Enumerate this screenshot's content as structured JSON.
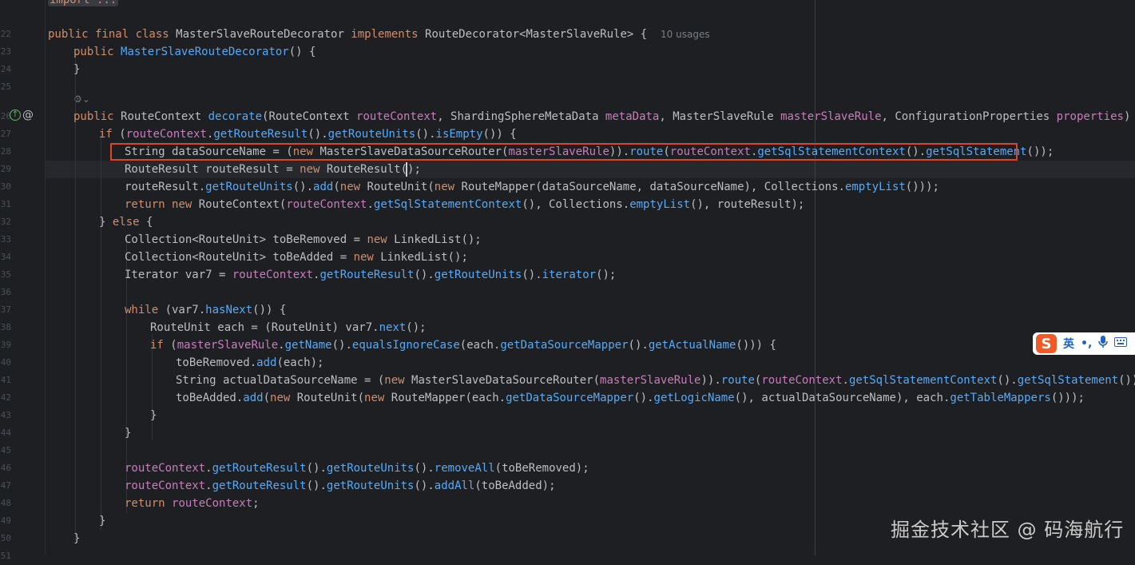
{
  "editor": {
    "line_numbers": [
      "",
      "22",
      "23",
      "24",
      "25",
      "26",
      "27",
      "28",
      "29",
      "30",
      "31",
      "32",
      "33",
      "34",
      "35",
      "36",
      "37",
      "38",
      "39",
      "40",
      "41",
      "42",
      "43",
      "44",
      "45",
      "46",
      "47",
      "48",
      "49",
      "50",
      "51"
    ],
    "usages_hint": "10 usages",
    "folded_import": "import ...",
    "lines": {
      "l0_kw": "import",
      "l0_rest": " ...",
      "l1_a": "public final class ",
      "l1_b": "MasterSlaveRouteDecorator",
      "l1_c": " implements ",
      "l1_d": "RouteDecorator<MasterSlaveRule> {",
      "l2_a": "public ",
      "l2_b": "MasterSlaveRouteDecorator",
      "l2_c": "() {",
      "l3": "}",
      "l5_a": "public ",
      "l5_b": "RouteContext ",
      "l5_c": "decorate",
      "l5_d": "(RouteContext ",
      "l5_e": "routeContext",
      "l5_f": ", ShardingSphereMetaData ",
      "l5_g": "metaData",
      "l5_h": ", MasterSlaveRule ",
      "l5_i": "masterSlaveRule",
      "l5_j": ", ConfigurationProperties ",
      "l5_k": "properties",
      "l5_l": ") {",
      "l6_a": "if ",
      "l6_b": "(",
      "l6_c": "routeContext",
      "l6_d": ".",
      "l6_e": "getRouteResult",
      "l6_f": "().",
      "l6_g": "getRouteUnits",
      "l6_h": "().",
      "l6_i": "isEmpty",
      "l6_j": "()) {",
      "l7_a": "String dataSourceName = (",
      "l7_b": "new ",
      "l7_c": "MasterSlaveDataSourceRouter(",
      "l7_d": "masterSlaveRule",
      "l7_e": ")).",
      "l7_f": "route",
      "l7_g": "(",
      "l7_h": "routeContext",
      "l7_i": ".",
      "l7_j": "getSqlStatementContext",
      "l7_k": "().",
      "l7_l": "getSqlStatement",
      "l7_m": "());",
      "l8_a": "RouteResult routeResult = ",
      "l8_b": "new ",
      "l8_c": "RouteResult();",
      "l9_a": "routeResult.",
      "l9_b": "getRouteUnits",
      "l9_c": "().",
      "l9_d": "add",
      "l9_e": "(",
      "l9_f": "new ",
      "l9_g": "RouteUnit(",
      "l9_h": "new ",
      "l9_i": "RouteMapper(dataSourceName, dataSourceName), Collections.",
      "l9_j": "emptyList",
      "l9_k": "()));",
      "l10_a": "return ",
      "l10_b": "new ",
      "l10_c": "RouteContext(",
      "l10_d": "routeContext",
      "l10_e": ".",
      "l10_f": "getSqlStatementContext",
      "l10_g": "(), Collections.",
      "l10_h": "emptyList",
      "l10_i": "(), routeResult);",
      "l11_a": "} ",
      "l11_b": "else",
      "l11_c": " {",
      "l12_a": "Collection<RouteUnit> toBeRemoved = ",
      "l12_b": "new ",
      "l12_c": "LinkedList();",
      "l13_a": "Collection<RouteUnit> toBeAdded = ",
      "l13_b": "new ",
      "l13_c": "LinkedList();",
      "l14_a": "Iterator var7 = ",
      "l14_b": "routeContext",
      "l14_c": ".",
      "l14_d": "getRouteResult",
      "l14_e": "().",
      "l14_f": "getRouteUnits",
      "l14_g": "().",
      "l14_h": "iterator",
      "l14_i": "();",
      "l16_a": "while ",
      "l16_b": "(var7.",
      "l16_c": "hasNext",
      "l16_d": "()) {",
      "l17_a": "RouteUnit each = (RouteUnit) var7.",
      "l17_b": "next",
      "l17_c": "();",
      "l18_a": "if ",
      "l18_b": "(",
      "l18_c": "masterSlaveRule",
      "l18_d": ".",
      "l18_e": "getName",
      "l18_f": "().",
      "l18_g": "equalsIgnoreCase",
      "l18_h": "(each.",
      "l18_i": "getDataSourceMapper",
      "l18_j": "().",
      "l18_k": "getActualName",
      "l18_l": "())) {",
      "l19_a": "toBeRemoved.",
      "l19_b": "add",
      "l19_c": "(each);",
      "l20_a": "String actualDataSourceName = (",
      "l20_b": "new ",
      "l20_c": "MasterSlaveDataSourceRouter(",
      "l20_d": "masterSlaveRule",
      "l20_e": ")).",
      "l20_f": "route",
      "l20_g": "(",
      "l20_h": "routeContext",
      "l20_i": ".",
      "l20_j": "getSqlStatementContext",
      "l20_k": "().",
      "l20_l": "getSqlStatement",
      "l20_m": "());",
      "l21_a": "toBeAdded.",
      "l21_b": "add",
      "l21_c": "(",
      "l21_d": "new ",
      "l21_e": "RouteUnit(",
      "l21_f": "new ",
      "l21_g": "RouteMapper(each.",
      "l21_h": "getDataSourceMapper",
      "l21_i": "().",
      "l21_j": "getLogicName",
      "l21_k": "(), actualDataSourceName), each.",
      "l21_l": "getTableMappers",
      "l21_m": "()));",
      "l22": "}",
      "l23": "}",
      "l25_a": "routeContext",
      "l25_b": ".",
      "l25_c": "getRouteResult",
      "l25_d": "().",
      "l25_e": "getRouteUnits",
      "l25_f": "().",
      "l25_g": "removeAll",
      "l25_h": "(toBeRemoved);",
      "l26_a": "routeContext",
      "l26_b": ".",
      "l26_c": "getRouteResult",
      "l26_d": "().",
      "l26_e": "getRouteUnits",
      "l26_f": "().",
      "l26_g": "addAll",
      "l26_h": "(toBeAdded);",
      "l27_a": "return ",
      "l27_b": "routeContext",
      "l27_c": ";",
      "l28": "}",
      "l29": "}"
    }
  },
  "ime_toolbar": {
    "logo": "S",
    "lang": "英",
    "punct": "•,",
    "mic_icon": "microphone-icon",
    "keyboard_icon": "keyboard-icon"
  },
  "watermark": "掘金技术社区 @ 码海航行",
  "colors": {
    "background": "#1e1f22",
    "keyword": "#cf8e6d",
    "method": "#57aaf7",
    "field": "#c77dbb",
    "highlight_box": "#d9472b"
  }
}
